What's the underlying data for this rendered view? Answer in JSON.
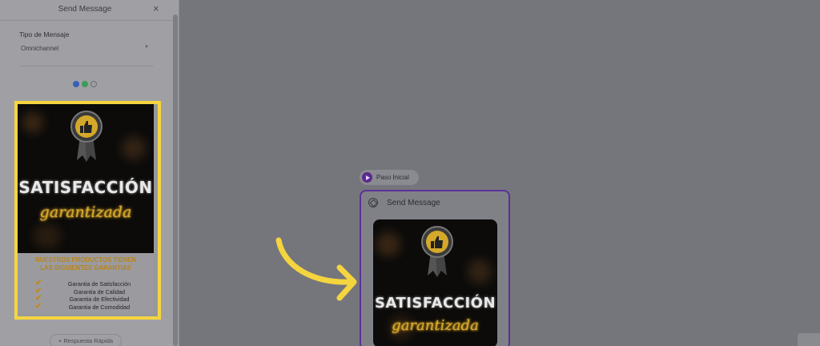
{
  "panel": {
    "title": "Send Message",
    "close_glyph": "×",
    "message_type_label": "Tipo de Mensaje",
    "message_type_value": "Omnichannel",
    "channel_icons": [
      "messenger-icon",
      "whatsapp-icon",
      "chat-icon"
    ],
    "quick_reply_label": "+ Respuesta Rápida"
  },
  "promo": {
    "title": "SATISFACCIÓN",
    "script": "garantizada",
    "heading_line1": "NUESTROS PRODUCTOS TIENEN",
    "heading_line2": "LAS SIGUIENTES GARANTIAS",
    "guarantees": [
      "Garantia de Satisfacción",
      "Garantia de Calidad",
      "Garantia de Efectividad",
      "Garantia de Comodidad"
    ]
  },
  "canvas": {
    "start_label": "Paso Inicial",
    "node_title": "Send Message"
  },
  "colors": {
    "highlight": "#f5d53f",
    "node_border": "#5b2f9b",
    "arrow": "#f5d53f",
    "gold": "#d6a92c"
  }
}
